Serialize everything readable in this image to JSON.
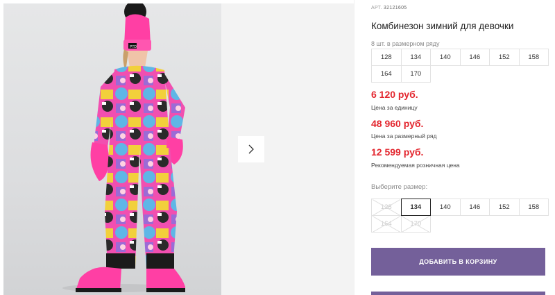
{
  "product": {
    "art_prefix": "АРТ.",
    "art_number": "32121605",
    "title": "Комбинезон зимний для девочки"
  },
  "pack": {
    "label": "8 шт. в размерном ряду",
    "sizes": [
      "128",
      "134",
      "140",
      "146",
      "152",
      "158",
      "164",
      "170"
    ]
  },
  "prices": [
    {
      "value": "6 120 руб.",
      "caption": "Цена за единицу"
    },
    {
      "value": "48 960 руб.",
      "caption": "Цена за размерный ряд"
    },
    {
      "value": "12 599 руб.",
      "caption": "Рекомендуемая розничная цена"
    }
  ],
  "size_select": {
    "label": "Выберите размер:",
    "options": [
      {
        "label": "128",
        "state": "disabled"
      },
      {
        "label": "134",
        "state": "selected"
      },
      {
        "label": "140",
        "state": "available"
      },
      {
        "label": "146",
        "state": "available"
      },
      {
        "label": "152",
        "state": "available"
      },
      {
        "label": "158",
        "state": "available"
      },
      {
        "label": "164",
        "state": "disabled"
      },
      {
        "label": "170",
        "state": "disabled"
      }
    ]
  },
  "cart": {
    "add_label": "ДОБАВИТЬ В КОРЗИНУ"
  },
  "gallery": {
    "next_icon": "chevron-right-icon",
    "hat_logo": "PTD"
  },
  "colors": {
    "accent": "#74609a",
    "price": "#e3262e",
    "hat": "#ff3fa4",
    "suit_pink": "#f14fb0",
    "suit_yellow": "#f2d03b",
    "suit_blue": "#5fb6e6"
  }
}
